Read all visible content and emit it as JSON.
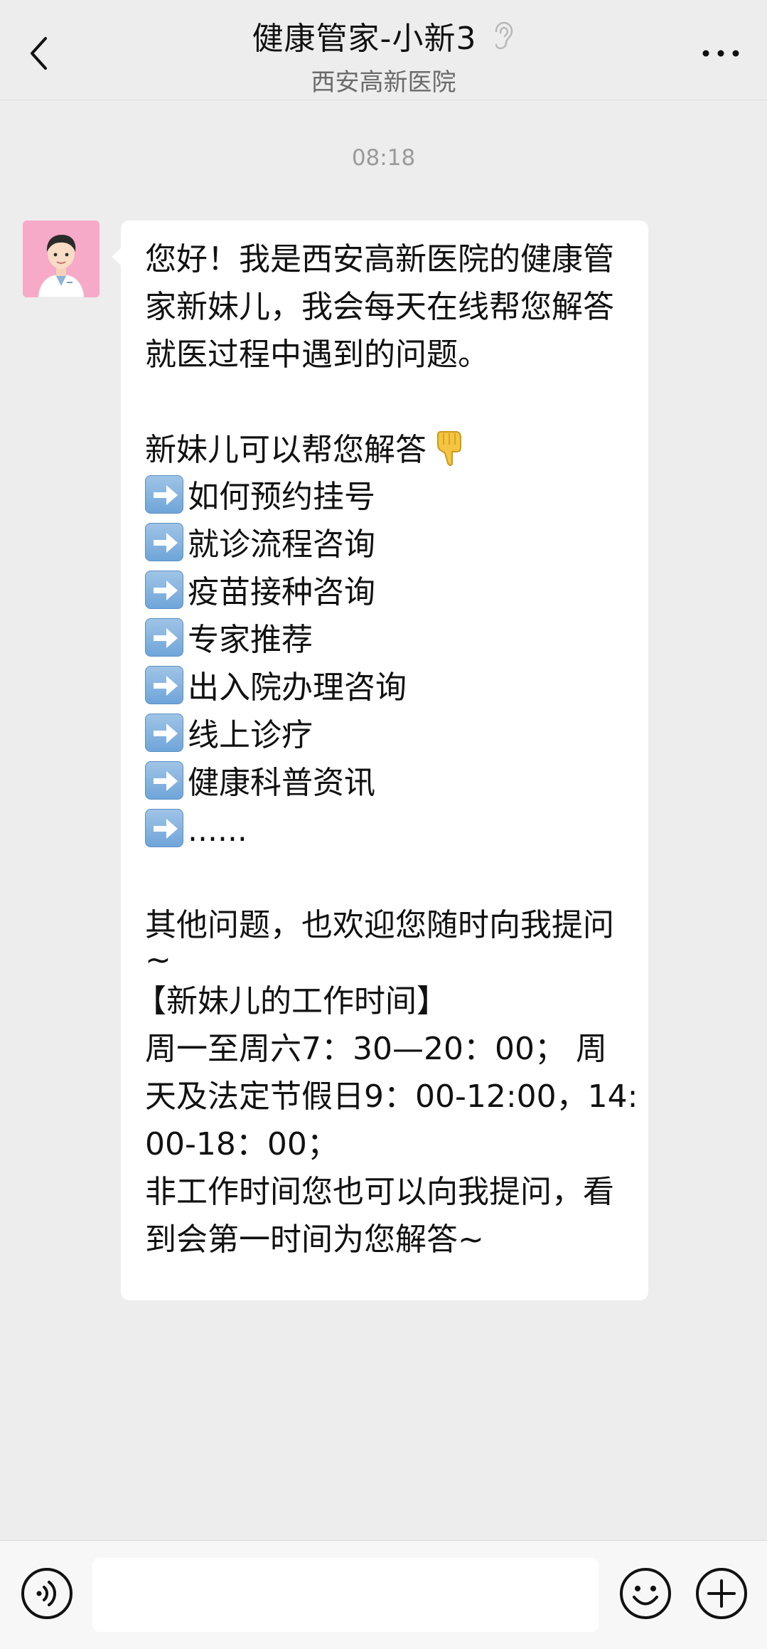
{
  "header": {
    "title": "健康管家-小新3",
    "subtitle": "西安高新医院",
    "back_icon": "chevron-left-icon",
    "ear_icon": "ear-icon",
    "more_icon": "more-dots-icon"
  },
  "chat": {
    "timestamp": "08:18",
    "message": {
      "intro": [
        "您好！我是西安高新医院的健康管",
        "家新妹儿，我会每天在线帮您解答",
        "就医过程中遇到的问题。"
      ],
      "help_heading": "新妹儿可以帮您解答",
      "help_items": [
        "如何预约挂号",
        "就诊流程咨询",
        "疫苗接种咨询",
        "专家推荐",
        "出入院办理咨询",
        "线上诊疗",
        "健康科普资讯",
        "......"
      ],
      "other_question": "其他问题，也欢迎您随时向我提问",
      "tilde": "~",
      "hours_heading": "【新妹儿的工作时间】",
      "hours_lines": [
        "周一至周六7：30—20：00； 周",
        "天及法定节假日9：00-12:00，14:",
        "00-18：00；"
      ],
      "offhours_lines": [
        "非工作时间您也可以向我提问，看",
        "到会第一时间为您解答~"
      ]
    }
  },
  "input_bar": {
    "voice_icon": "voice-icon",
    "emoji_icon": "emoji-icon",
    "plus_icon": "plus-icon",
    "input_value": ""
  },
  "colors": {
    "background": "#ededed",
    "bubble": "#ffffff",
    "avatar_bg": "#f7a9c8",
    "arrow_emoji": "#6fa5d9"
  }
}
